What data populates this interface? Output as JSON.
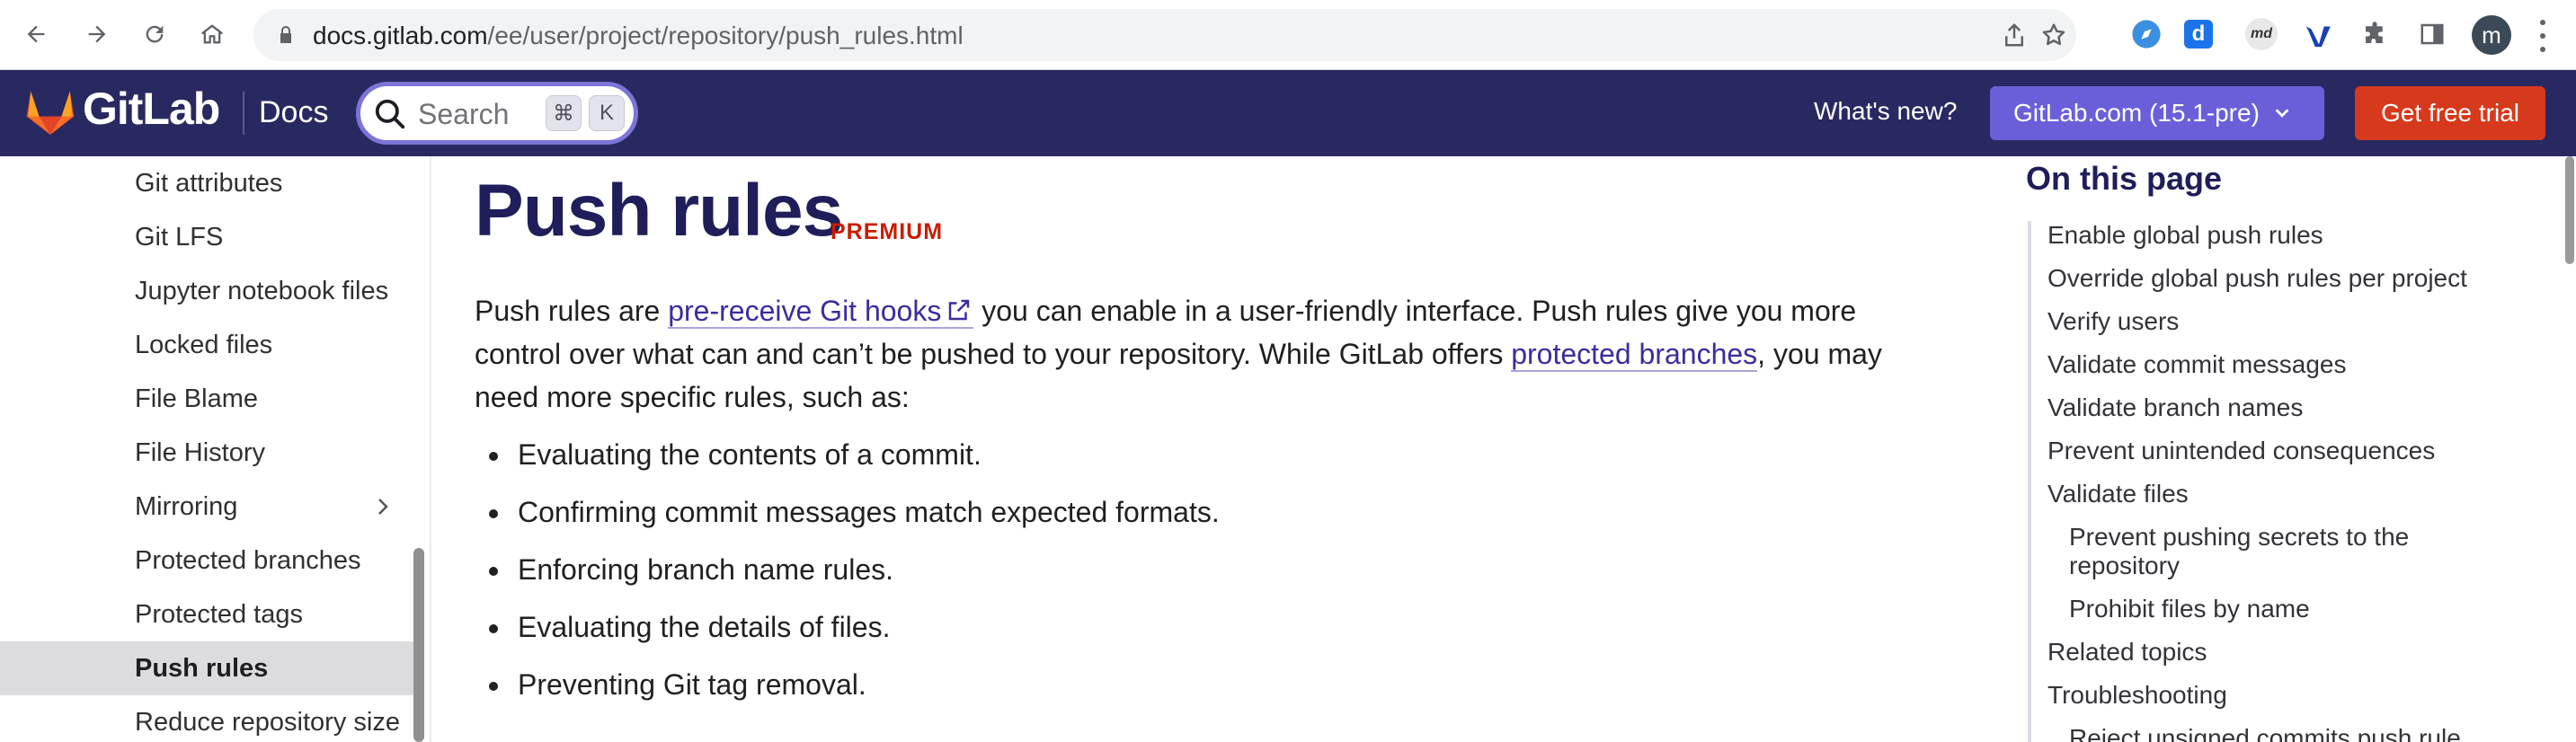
{
  "browser": {
    "url_host": "docs.gitlab.com",
    "url_path": "/ee/user/project/repository/push_rules.html",
    "profile_initial": "m",
    "extensions": [
      "compass-icon",
      "dict-icon",
      "markdown-icon",
      "vimeo-icon",
      "puzzle-icon",
      "sidepanel-icon"
    ],
    "ext_labels": {
      "dict": "d",
      "markdown": "md"
    }
  },
  "header": {
    "brand": "GitLab",
    "section": "Docs",
    "search_placeholder": "Search",
    "shortcut_keys": [
      "⌘",
      "K"
    ],
    "whats_new": "What's new?",
    "version_label": "GitLab.com (15.1-pre)",
    "trial_label": "Get free trial"
  },
  "sidebar": {
    "items": [
      {
        "label": "Git attributes",
        "active": false
      },
      {
        "label": "Git LFS",
        "active": false
      },
      {
        "label": "Jupyter notebook files",
        "active": false
      },
      {
        "label": "Locked files",
        "active": false
      },
      {
        "label": "File Blame",
        "active": false
      },
      {
        "label": "File History",
        "active": false
      },
      {
        "label": "Mirroring",
        "active": false,
        "expandable": true
      },
      {
        "label": "Protected branches",
        "active": false
      },
      {
        "label": "Protected tags",
        "active": false
      },
      {
        "label": "Push rules",
        "active": true
      },
      {
        "label": "Reduce repository size",
        "active": false
      }
    ]
  },
  "main": {
    "title": "Push rules",
    "tier": "PREMIUM",
    "intro": {
      "p1": "Push rules are ",
      "link1": "pre-receive Git hooks",
      "p2": " you can enable in a user-friendly interface. Push rules give you more control over what can and can’t be pushed to your repository. While GitLab offers ",
      "link2": "protected branches",
      "p3": ", you may need more specific rules, such as:"
    },
    "bullets": [
      "Evaluating the contents of a commit.",
      "Confirming commit messages match expected formats.",
      "Enforcing branch name rules.",
      "Evaluating the details of files.",
      "Preventing Git tag removal."
    ]
  },
  "toc": {
    "heading": "On this page",
    "items": [
      {
        "label": "Enable global push rules",
        "level": 1
      },
      {
        "label": "Override global push rules per project",
        "level": 1
      },
      {
        "label": "Verify users",
        "level": 1
      },
      {
        "label": "Validate commit messages",
        "level": 1
      },
      {
        "label": "Validate branch names",
        "level": 1
      },
      {
        "label": "Prevent unintended consequences",
        "level": 1
      },
      {
        "label": "Validate files",
        "level": 1
      },
      {
        "label": "Prevent pushing secrets to the repository",
        "level": 2
      },
      {
        "label": "Prohibit files by name",
        "level": 2
      },
      {
        "label": "Related topics",
        "level": 1
      },
      {
        "label": "Troubleshooting",
        "level": 1
      },
      {
        "label": "Reject unsigned commits push rule",
        "level": 2
      }
    ]
  },
  "colors": {
    "header_bg": "#292961",
    "version_btn": "#6b5fd9",
    "trial_btn": "#d7391c",
    "link": "#3a2d9e",
    "tier": "#c91c00"
  }
}
